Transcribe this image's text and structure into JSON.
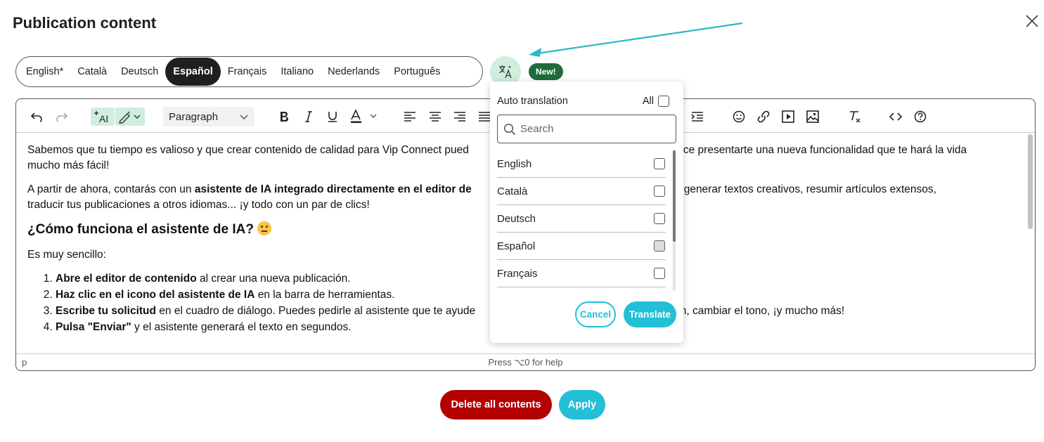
{
  "dialog": {
    "title": "Publication content"
  },
  "languages": {
    "tabs": [
      "English*",
      "Català",
      "Deutsch",
      "Español",
      "Français",
      "Italiano",
      "Nederlands",
      "Português"
    ],
    "active": "Español"
  },
  "badge": {
    "new_label": "New!"
  },
  "toolbar": {
    "paragraph_label": "Paragraph",
    "ai_label": "AI"
  },
  "content": {
    "p1": "Sabemos que tu tiempo es valioso y que crear contenido de calidad para Vip Connect pued",
    "p1b": "ce presentarte una nueva funcionalidad que te hará la vida",
    "p1c": "mucho más fácil!",
    "p2a": "A partir de ahora, contarás con un ",
    "p2bold": "asistente de IA integrado directamente en el editor de",
    "p2rest": "poder generar textos creativos, resumir artículos extensos,",
    "p2c": "traducir tus publicaciones a otros idiomas... ¡y todo con un par de clics!",
    "heading": "¿Cómo funciona el asistente de IA? ",
    "p3": "Es muy sencillo:",
    "steps": [
      {
        "bold": "Abre el editor de contenido",
        "text": " al crear una nueva publicación."
      },
      {
        "bold": "Haz clic en el icono del asistente de IA",
        "text": " en la barra de herramientas."
      },
      {
        "bold": "Escribe tu solicitud",
        "text": " en el cuadro de diálogo. Puedes pedirle al asistente que te ayude",
        "tail": "ón, cambiar el tono, ¡y mucho más!"
      },
      {
        "bold": "Pulsa \"Enviar\"",
        "text": " y el asistente generará el texto en segundos."
      }
    ]
  },
  "statusbar": {
    "path": "p",
    "help": "Press ⌥0 for help"
  },
  "auto_translation": {
    "title": "Auto translation",
    "all_label": "All",
    "search_placeholder": "Search",
    "items": [
      {
        "label": "English",
        "checked": false
      },
      {
        "label": "Català",
        "checked": false
      },
      {
        "label": "Deutsch",
        "checked": false
      },
      {
        "label": "Español",
        "checked": true
      },
      {
        "label": "Français",
        "checked": false
      }
    ],
    "cancel_label": "Cancel",
    "translate_label": "Translate"
  },
  "footer": {
    "delete_label": "Delete all contents",
    "apply_label": "Apply"
  },
  "colors": {
    "accent": "#22bfd6",
    "danger": "#b30000",
    "badge": "#1e6b3b",
    "ai_green": "#cfeedd"
  }
}
